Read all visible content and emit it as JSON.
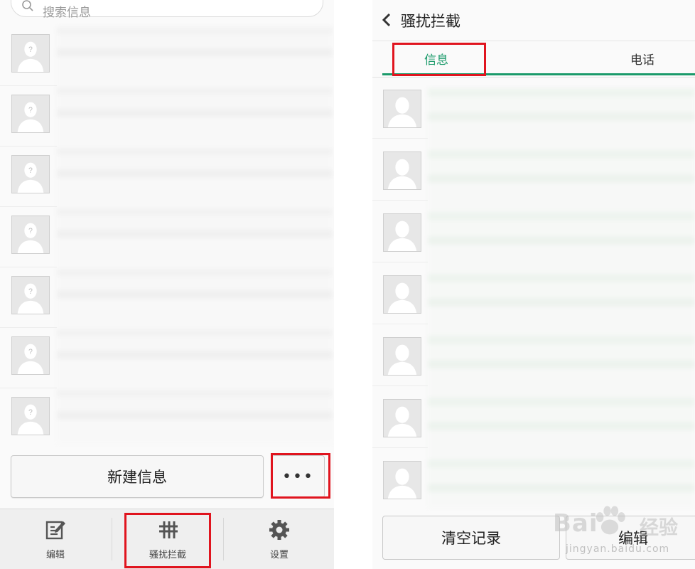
{
  "left": {
    "search": {
      "placeholder": "搜索信息"
    },
    "new_message_label": "新建信息",
    "more_label": "•••",
    "bottom_nav": [
      {
        "label": "编辑",
        "icon": "compose-icon"
      },
      {
        "label": "骚扰拦截",
        "icon": "hash-icon"
      },
      {
        "label": "设置",
        "icon": "gear-icon"
      }
    ]
  },
  "right": {
    "header": {
      "title": "骚扰拦截",
      "back_icon": "back-icon"
    },
    "tabs": [
      {
        "label": "信息",
        "active": true
      },
      {
        "label": "电话",
        "active": false
      }
    ],
    "clear_label": "清空记录",
    "edit_label": "编辑"
  },
  "watermark": {
    "brand": "Bai",
    "brand_cn": "经验",
    "url": "jingyan.baidu.com"
  },
  "colors": {
    "accent": "#1a9a6a",
    "highlight": "#e0141e"
  }
}
